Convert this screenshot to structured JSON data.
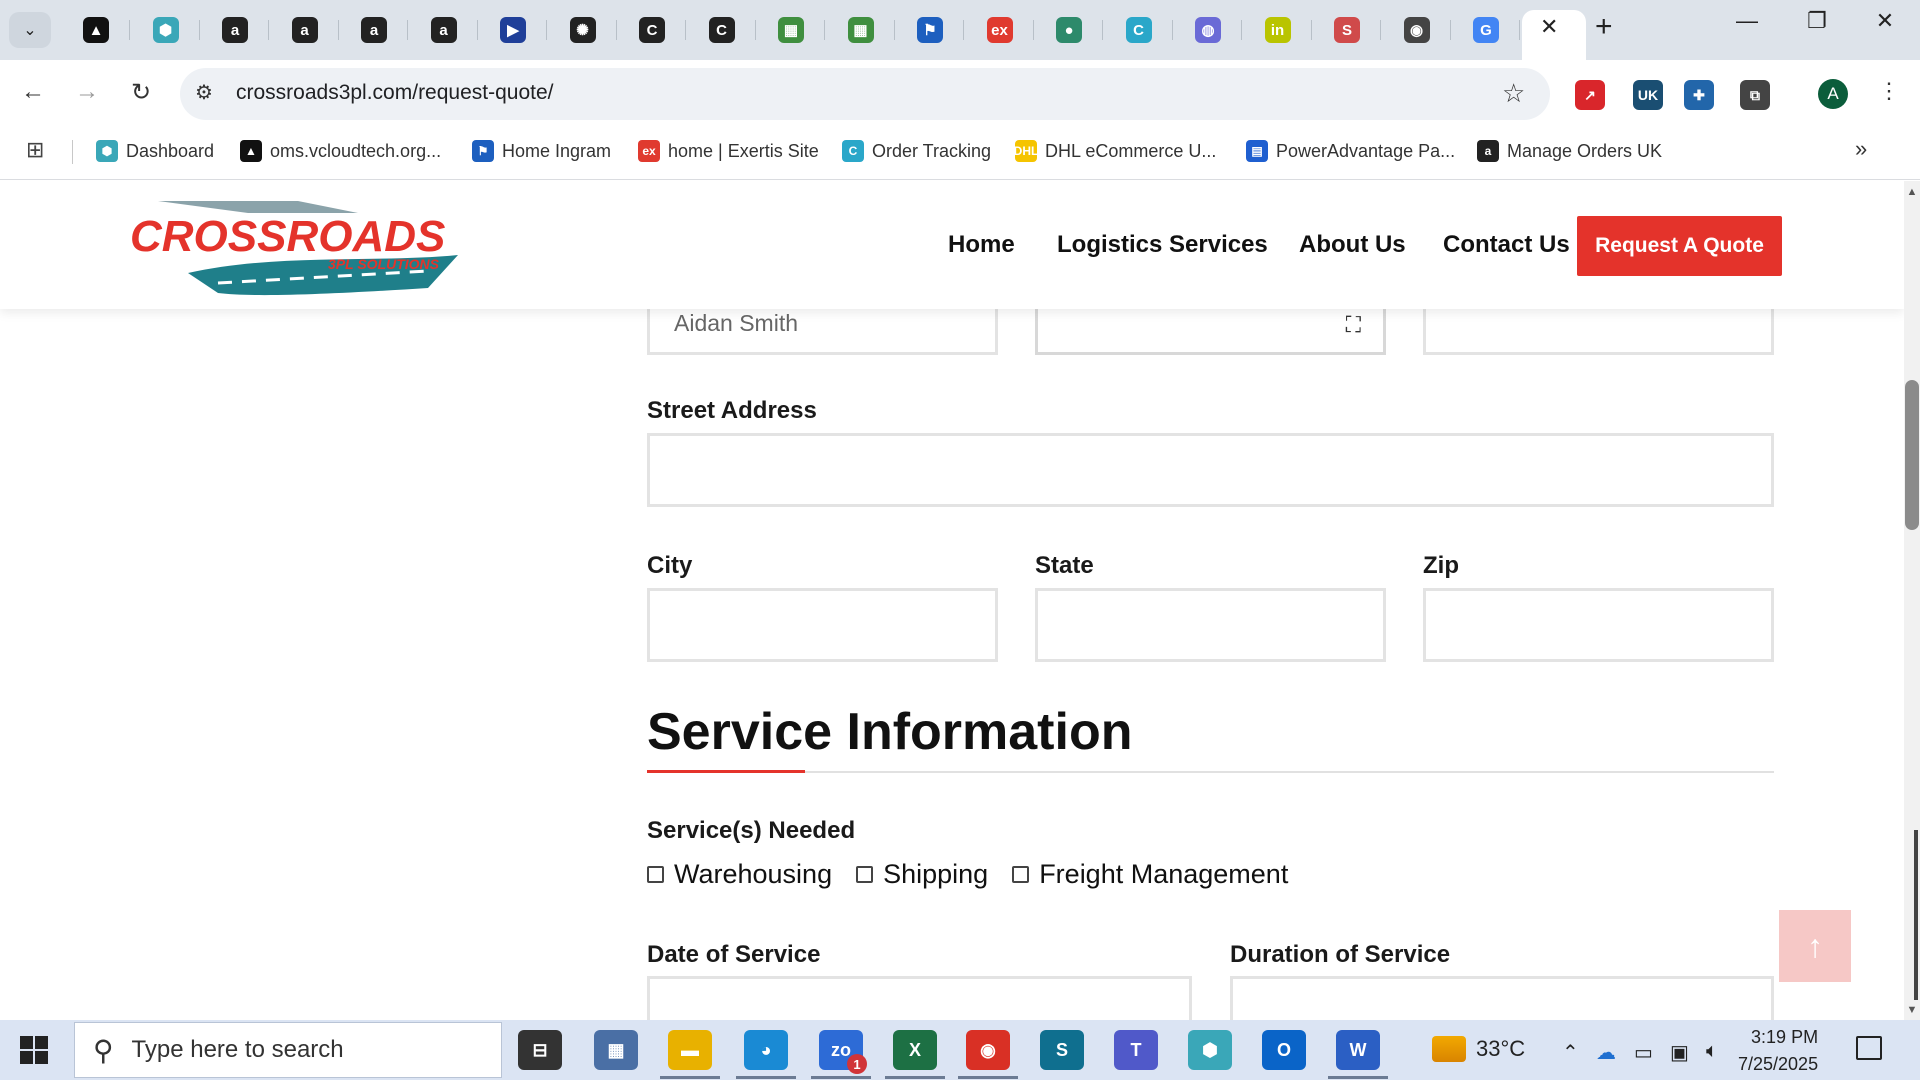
{
  "browser": {
    "tabs": [
      {
        "icon": "ozon-icon",
        "glyph": "▲",
        "color": "#111111"
      },
      {
        "icon": "hexagon-app-icon",
        "glyph": "⬢",
        "color": "#3aa7b8"
      },
      {
        "icon": "amazon-icon",
        "glyph": "a",
        "color": "#222222"
      },
      {
        "icon": "amazon-icon",
        "glyph": "a",
        "color": "#222222"
      },
      {
        "icon": "amazon-icon",
        "glyph": "a",
        "color": "#222222"
      },
      {
        "icon": "amazon-icon",
        "glyph": "a",
        "color": "#222222"
      },
      {
        "icon": "play-arrow-icon",
        "glyph": "▶",
        "color": "#1f3f99"
      },
      {
        "icon": "chatgpt-icon",
        "glyph": "✺",
        "color": "#222222"
      },
      {
        "icon": "c-logo-icon",
        "glyph": "C",
        "color": "#222222"
      },
      {
        "icon": "c-logo-icon",
        "glyph": "C",
        "color": "#222222"
      },
      {
        "icon": "ingram-building-icon",
        "glyph": "▦",
        "color": "#3f8f3f"
      },
      {
        "icon": "ingram-building-icon",
        "glyph": "▦",
        "color": "#3f8f3f"
      },
      {
        "icon": "flag-icon",
        "glyph": "⚑",
        "color": "#1d5fbf"
      },
      {
        "icon": "exertis-icon",
        "glyph": "ex",
        "color": "#e03a2f"
      },
      {
        "icon": "bird-icon",
        "glyph": "●",
        "color": "#2d8a6b"
      },
      {
        "icon": "c-circle-icon",
        "glyph": "C",
        "color": "#2aa7c9"
      },
      {
        "icon": "chart-circle-icon",
        "glyph": "◍",
        "color": "#6a6ad6"
      },
      {
        "icon": "infos-icon",
        "glyph": "in",
        "color": "#b9c400"
      },
      {
        "icon": "sheets-icon",
        "glyph": "S",
        "color": "#d04a4a"
      },
      {
        "icon": "chrome-icon",
        "glyph": "◉",
        "color": "#444444"
      },
      {
        "icon": "google-icon",
        "glyph": "G",
        "color": "#4285f4"
      }
    ],
    "url": "crossroads3pl.com/request-quote/",
    "profile_initial": "A",
    "extensions": [
      {
        "icon": "pdf-icon",
        "glyph": "↗",
        "color": "#d9262b"
      },
      {
        "icon": "uk-globe-icon",
        "glyph": "UK",
        "color": "#1a4e72"
      },
      {
        "icon": "puzzle-sync-icon",
        "glyph": "✚",
        "color": "#2266aa"
      },
      {
        "icon": "extensions-icon",
        "glyph": "⧉",
        "color": "#444444"
      }
    ],
    "bookmarks": [
      {
        "label": "Dashboard",
        "icon": "hexagon-app-icon",
        "glyph": "⬢",
        "color": "#3aa7b8"
      },
      {
        "label": "oms.vcloudtech.org...",
        "icon": "ozon-icon",
        "glyph": "▲",
        "color": "#111111"
      },
      {
        "label": "Home Ingram",
        "icon": "flag-icon",
        "glyph": "⚑",
        "color": "#1d5fbf"
      },
      {
        "label": "home | Exertis Site",
        "icon": "exertis-icon",
        "glyph": "ex",
        "color": "#e03a2f"
      },
      {
        "label": "Order Tracking",
        "icon": "c-circle-icon",
        "glyph": "C",
        "color": "#2aa7c9"
      },
      {
        "label": "DHL eCommerce U...",
        "icon": "dhl-icon",
        "glyph": "DHL",
        "color": "#f5c400"
      },
      {
        "label": "PowerAdvantage Pa...",
        "icon": "document-icon",
        "glyph": "▤",
        "color": "#1f5fd0"
      },
      {
        "label": "Manage Orders UK",
        "icon": "amazon-icon",
        "glyph": "a",
        "color": "#222222"
      }
    ]
  },
  "site": {
    "logo_main": "CROSSROADS",
    "logo_sub": "3PL SOLUTIONS",
    "nav": [
      "Home",
      "Logistics Services",
      "About Us",
      "Contact Us"
    ],
    "cta": "Request A Quote"
  },
  "form": {
    "name_value": "Aidan Smith",
    "street_label": "Street Address",
    "city_label": "City",
    "state_label": "State",
    "zip_label": "Zip",
    "section_title": "Service Information",
    "services_label": "Service(s) Needed",
    "services": [
      "Warehousing",
      "Shipping",
      "Freight Management"
    ],
    "date_label": "Date of Service",
    "duration_label": "Duration of Service"
  },
  "taskbar": {
    "search_placeholder": "Type here to search",
    "temperature": "33°C",
    "time": "3:19 PM",
    "date": "7/25/2025",
    "zoom_badge": "1",
    "apps": [
      {
        "icon": "task-view-icon",
        "glyph": "⊟",
        "color": "#333333"
      },
      {
        "icon": "calculator-icon",
        "glyph": "▦",
        "color": "#4a6fa5"
      },
      {
        "icon": "file-explorer-icon",
        "glyph": "▬",
        "color": "#e8b100"
      },
      {
        "icon": "edge-icon",
        "glyph": "◕",
        "color": "#1a8ad4"
      },
      {
        "icon": "zoom-icon",
        "glyph": "zo",
        "color": "#2d6bd6"
      },
      {
        "icon": "excel-icon",
        "glyph": "X",
        "color": "#1d7044"
      },
      {
        "icon": "chrome-icon",
        "glyph": "◉",
        "color": "#d93025"
      },
      {
        "icon": "s-app-icon",
        "glyph": "S",
        "color": "#0f6f8f"
      },
      {
        "icon": "teams-icon",
        "glyph": "T",
        "color": "#5059c9"
      },
      {
        "icon": "hexagon-app-icon",
        "glyph": "⬢",
        "color": "#3aa7b8"
      },
      {
        "icon": "outlook-icon",
        "glyph": "O",
        "color": "#0a64c8"
      },
      {
        "icon": "word-icon",
        "glyph": "W",
        "color": "#2b5fc4"
      }
    ]
  },
  "colors": {
    "accent": "#e4332b",
    "taskbar": "#dbe4f3",
    "tabstrip": "#dde3ea"
  }
}
